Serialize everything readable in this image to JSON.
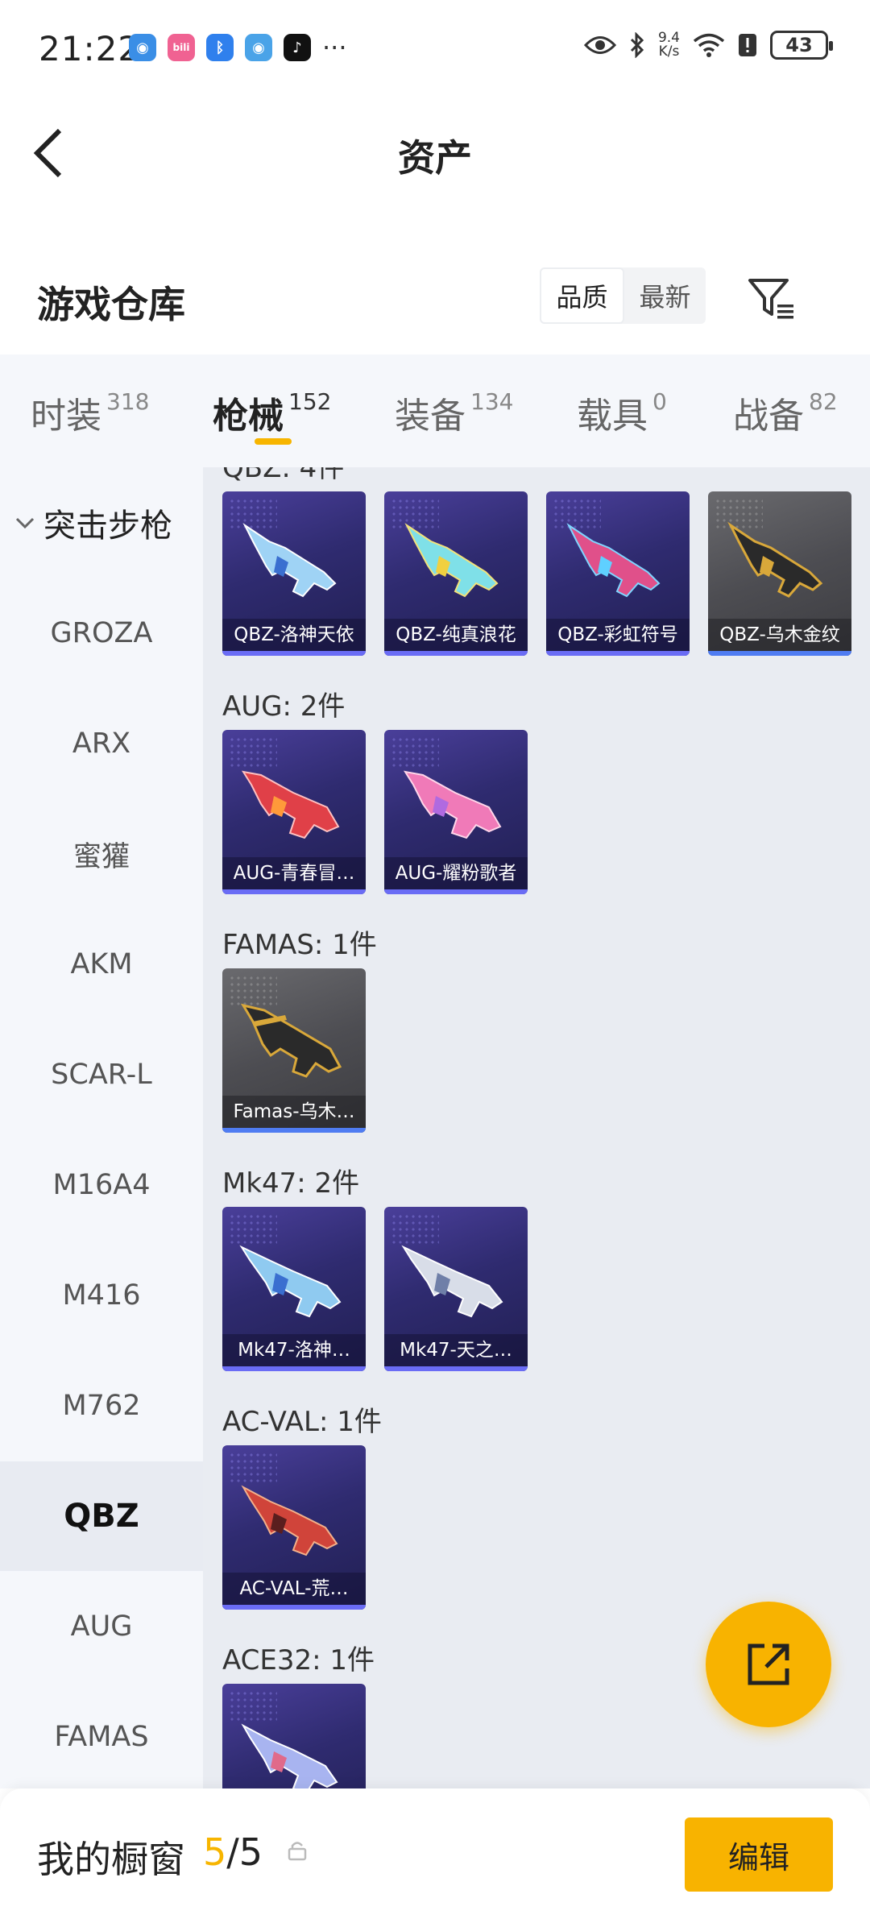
{
  "status": {
    "time": "21:22",
    "net_speed_top": "9.4",
    "net_speed_bottom": "K/s",
    "battery": "43"
  },
  "header": {
    "title": "资产"
  },
  "section": {
    "title": "游戏仓库",
    "sort_options": [
      "品质",
      "最新"
    ],
    "sort_active": "品质"
  },
  "categories": [
    {
      "label": "时装",
      "count": "318"
    },
    {
      "label": "枪械",
      "count": "152"
    },
    {
      "label": "装备",
      "count": "134"
    },
    {
      "label": "载具",
      "count": "0"
    },
    {
      "label": "战备",
      "count": "82"
    }
  ],
  "sidebar": {
    "head": "突击步枪",
    "items": [
      "GROZA",
      "ARX",
      "蜜獾",
      "AKM",
      "SCAR-L",
      "M16A4",
      "M416",
      "M762",
      "QBZ",
      "AUG",
      "FAMAS"
    ],
    "active": "QBZ"
  },
  "groups": [
    {
      "title": "QBZ: 4件",
      "items": [
        {
          "name": "QBZ-洛神天依",
          "style": "purple"
        },
        {
          "name": "QBZ-纯真浪花",
          "style": "purple"
        },
        {
          "name": "QBZ-彩虹符号",
          "style": "purple"
        },
        {
          "name": "QBZ-乌木金纹",
          "style": "gold"
        }
      ]
    },
    {
      "title": "AUG: 2件",
      "items": [
        {
          "name": "AUG-青春冒…",
          "style": "purple"
        },
        {
          "name": "AUG-耀粉歌者",
          "style": "purple"
        }
      ]
    },
    {
      "title": "FAMAS: 1件",
      "items": [
        {
          "name": "Famas-乌木…",
          "style": "gold"
        }
      ]
    },
    {
      "title": "Mk47: 2件",
      "items": [
        {
          "name": "Mk47-洛神…",
          "style": "purple"
        },
        {
          "name": "Mk47-天之…",
          "style": "purple"
        }
      ]
    },
    {
      "title": "AC-VAL: 1件",
      "items": [
        {
          "name": "AC-VAL-荒…",
          "style": "purple"
        }
      ]
    },
    {
      "title": "ACE32: 1件",
      "items": [
        {
          "name": "",
          "style": "purple"
        }
      ]
    }
  ],
  "bottom": {
    "label": "我的橱窗",
    "current": "5",
    "total": "/5",
    "edit_label": "编辑"
  }
}
